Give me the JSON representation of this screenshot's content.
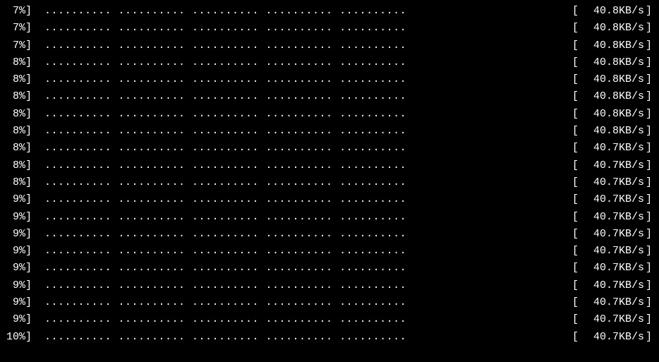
{
  "rows": [
    {
      "percent": "7%]",
      "dots": ".......... .......... .......... .......... ..........",
      "bracket_open": "[",
      "speed": "40.8KB/s",
      "bracket_close": "]"
    },
    {
      "percent": "7%]",
      "dots": ".......... .......... .......... .......... ..........",
      "bracket_open": "[",
      "speed": "40.8KB/s",
      "bracket_close": "]"
    },
    {
      "percent": "7%]",
      "dots": ".......... .......... .......... .......... ..........",
      "bracket_open": "[",
      "speed": "40.8KB/s",
      "bracket_close": "]"
    },
    {
      "percent": "8%]",
      "dots": ".......... .......... .......... .......... ..........",
      "bracket_open": "[",
      "speed": "40.8KB/s",
      "bracket_close": "]"
    },
    {
      "percent": "8%]",
      "dots": ".......... .......... .......... .......... ..........",
      "bracket_open": "[",
      "speed": "40.8KB/s",
      "bracket_close": "]"
    },
    {
      "percent": "8%]",
      "dots": ".......... .......... .......... .......... ..........",
      "bracket_open": "[",
      "speed": "40.8KB/s",
      "bracket_close": "]"
    },
    {
      "percent": "8%]",
      "dots": ".......... .......... .......... .......... ..........",
      "bracket_open": "[",
      "speed": "40.8KB/s",
      "bracket_close": "]"
    },
    {
      "percent": "8%]",
      "dots": ".......... .......... .......... .......... ..........",
      "bracket_open": "[",
      "speed": "40.8KB/s",
      "bracket_close": "]"
    },
    {
      "percent": "8%]",
      "dots": ".......... .......... .......... .......... ..........",
      "bracket_open": "[",
      "speed": "40.7KB/s",
      "bracket_close": "]"
    },
    {
      "percent": "8%]",
      "dots": ".......... .......... .......... .......... ..........",
      "bracket_open": "[",
      "speed": "40.7KB/s",
      "bracket_close": "]"
    },
    {
      "percent": "8%]",
      "dots": ".......... .......... .......... .......... ..........",
      "bracket_open": "[",
      "speed": "40.7KB/s",
      "bracket_close": "]"
    },
    {
      "percent": "9%]",
      "dots": ".......... .......... .......... .......... ..........",
      "bracket_open": "[",
      "speed": "40.7KB/s",
      "bracket_close": "]"
    },
    {
      "percent": "9%]",
      "dots": ".......... .......... .......... .......... ..........",
      "bracket_open": "[",
      "speed": "40.7KB/s",
      "bracket_close": "]"
    },
    {
      "percent": "9%]",
      "dots": ".......... .......... .......... .......... ..........",
      "bracket_open": "[",
      "speed": "40.7KB/s",
      "bracket_close": "]"
    },
    {
      "percent": "9%]",
      "dots": ".......... .......... .......... .......... ..........",
      "bracket_open": "[",
      "speed": "40.7KB/s",
      "bracket_close": "]"
    },
    {
      "percent": "9%]",
      "dots": ".......... .......... .......... .......... ..........",
      "bracket_open": "[",
      "speed": "40.7KB/s",
      "bracket_close": "]"
    },
    {
      "percent": "9%]",
      "dots": ".......... .......... .......... .......... ..........",
      "bracket_open": "[",
      "speed": "40.7KB/s",
      "bracket_close": "]"
    },
    {
      "percent": "9%]",
      "dots": ".......... .......... .......... .......... ..........",
      "bracket_open": "[",
      "speed": "40.7KB/s",
      "bracket_close": "]"
    },
    {
      "percent": "9%]",
      "dots": ".......... .......... .......... .......... ..........",
      "bracket_open": "[",
      "speed": "40.7KB/s",
      "bracket_close": "]"
    },
    {
      "percent": "10%]",
      "dots": ".......... .......... .......... .......... ..........",
      "bracket_open": "[",
      "speed": "40.7KB/s",
      "bracket_close": "]"
    }
  ]
}
